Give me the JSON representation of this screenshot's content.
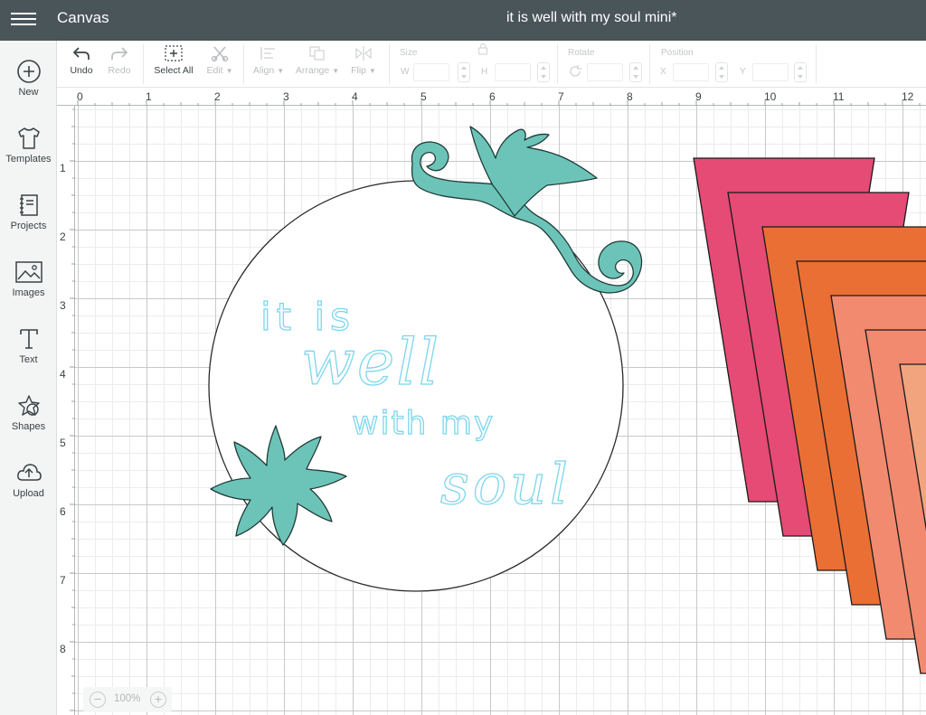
{
  "app": {
    "title": "Canvas",
    "project_title": "it is well with my soul mini*"
  },
  "sidebar": {
    "items": [
      {
        "label": "New",
        "icon": "plus-circle-icon"
      },
      {
        "label": "Templates",
        "icon": "tshirt-icon"
      },
      {
        "label": "Projects",
        "icon": "notebook-icon"
      },
      {
        "label": "Images",
        "icon": "image-icon"
      },
      {
        "label": "Text",
        "icon": "text-icon"
      },
      {
        "label": "Shapes",
        "icon": "shapes-icon"
      },
      {
        "label": "Upload",
        "icon": "cloud-upload-icon"
      }
    ]
  },
  "toolbar": {
    "undo": "Undo",
    "redo": "Redo",
    "select_all": "Select All",
    "edit": "Edit",
    "align": "Align",
    "arrange": "Arrange",
    "flip": "Flip",
    "size_label": "Size",
    "w_label": "W",
    "h_label": "H",
    "rotate_label": "Rotate",
    "position_label": "Position",
    "x_label": "X",
    "y_label": "Y"
  },
  "rulers": {
    "horizontal": [
      "0",
      "1",
      "2",
      "3",
      "4",
      "5",
      "6",
      "7",
      "8",
      "9",
      "10",
      "11",
      "12"
    ],
    "vertical": [
      "1",
      "2",
      "3",
      "4",
      "5",
      "6",
      "7",
      "8"
    ]
  },
  "design": {
    "words": [
      "it is",
      "well",
      "with my",
      "soul"
    ],
    "colors": {
      "teal": "#6cc4b8",
      "text_blue": "#7dd6ec",
      "pink": "#e54b74",
      "orange": "#ea6f34",
      "salmon": "#f18a6f",
      "peach": "#f2a47f"
    }
  },
  "zoom": {
    "value": "100%",
    "minus": "−",
    "plus": "+"
  }
}
